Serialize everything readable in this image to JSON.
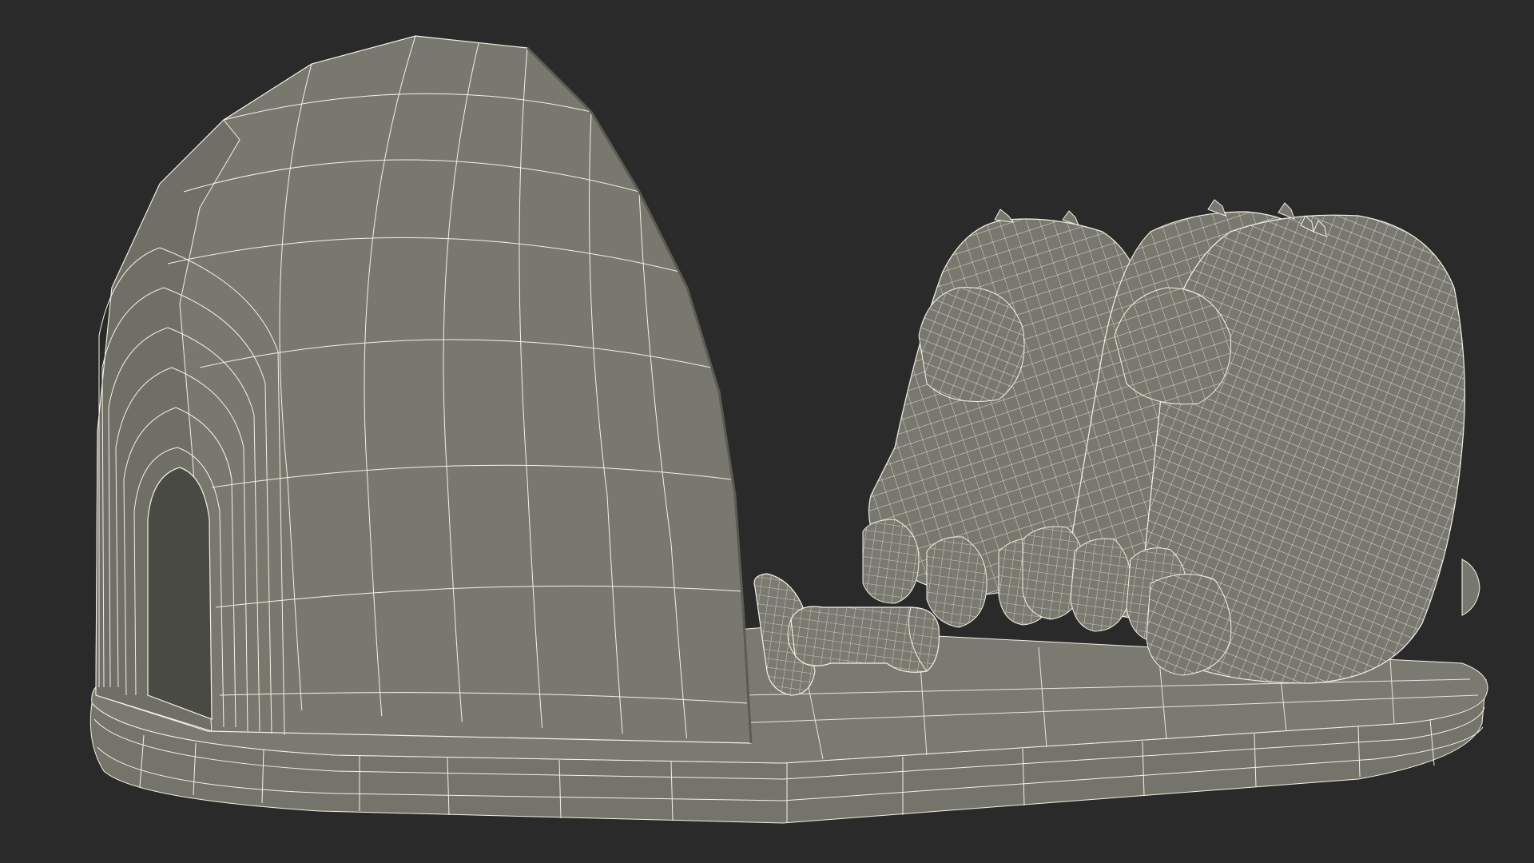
{
  "scene": {
    "background_color": "#2a2a2a",
    "mesh_fill": "#78786e",
    "mesh_fill_dark": "#5e5e56",
    "mesh_fill_light": "#83837a",
    "wire_color": "#f2f2e6",
    "objects": [
      "igloo",
      "base-platform",
      "campfire-logs",
      "bear-left",
      "bear-right"
    ]
  }
}
